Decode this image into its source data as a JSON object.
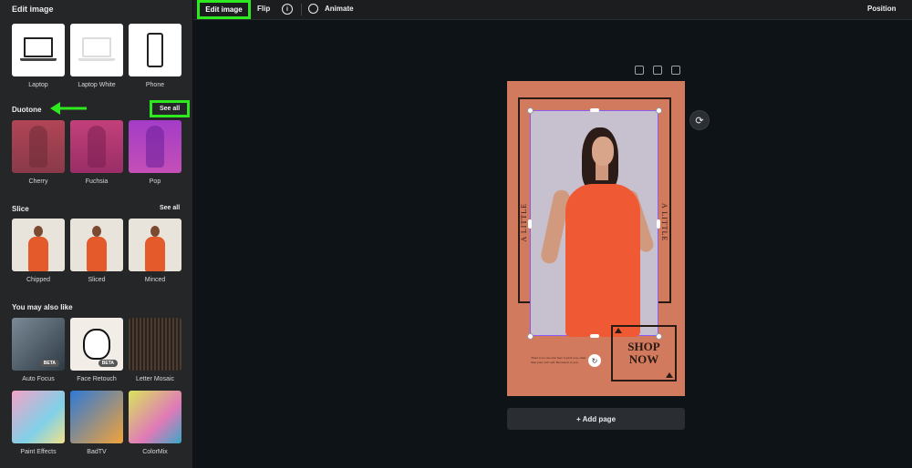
{
  "panel": {
    "title": "Edit image"
  },
  "devices": {
    "items": [
      {
        "label": "Laptop",
        "icon": "laptop-icon"
      },
      {
        "label": "Laptop White",
        "icon": "laptop-white-icon"
      },
      {
        "label": "Phone",
        "icon": "phone-icon"
      }
    ]
  },
  "duotone": {
    "title": "Duotone",
    "see_all": "See all",
    "items": [
      {
        "label": "Cherry",
        "color": "#b04556"
      },
      {
        "label": "Fuchsia",
        "color": "#c2407a"
      },
      {
        "label": "Pop",
        "color": "#a33cc7"
      }
    ]
  },
  "slice": {
    "title": "Slice",
    "see_all": "See all",
    "items": [
      {
        "label": "Chipped"
      },
      {
        "label": "Sliced"
      },
      {
        "label": "Minced"
      }
    ]
  },
  "also_like": {
    "title": "You may also like",
    "items": [
      {
        "label": "Auto Focus",
        "badge": "BETA"
      },
      {
        "label": "Face Retouch",
        "badge": "BETA"
      },
      {
        "label": "Letter Mosaic"
      },
      {
        "label": "Paint Effects"
      },
      {
        "label": "BadTV"
      },
      {
        "label": "ColorMix"
      }
    ]
  },
  "topbar": {
    "edit_image": "Edit image",
    "flip": "Flip",
    "info_symbol": "i",
    "animate": "Animate",
    "position": "Position"
  },
  "design": {
    "side_text_left": "A LITTLE",
    "side_text_right": "A LITTLE",
    "shop_line1": "SHOP",
    "shop_line2": "NOW",
    "small_copy": "There is no one else here to pick you, other than your own self. Because it is you."
  },
  "canvas": {
    "add_page": "+ Add page",
    "refresh_symbol": "⟳",
    "rotate_symbol": "↻"
  },
  "colors": {
    "highlight": "#2ee820",
    "panel_bg": "#252627",
    "canvas_bg": "#0e1318",
    "design_bg": "#d27a5e"
  }
}
